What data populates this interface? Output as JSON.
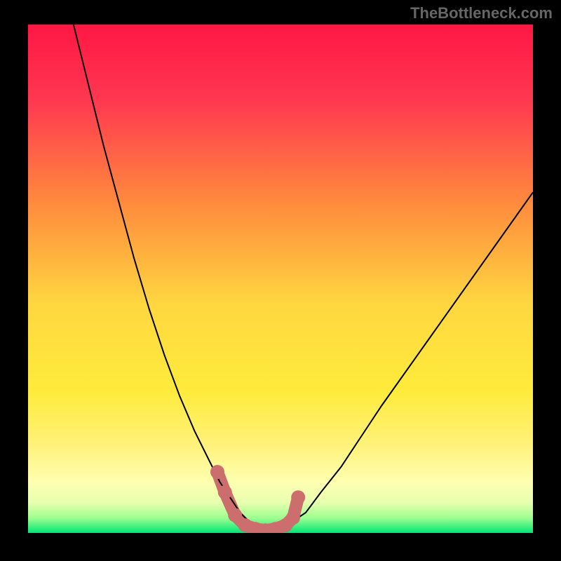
{
  "watermark": "TheBottleneck.com",
  "chart_data": {
    "type": "line",
    "title": "",
    "xlabel": "",
    "ylabel": "",
    "xlim": [
      0,
      100
    ],
    "ylim": [
      0,
      100
    ],
    "background_gradient": {
      "stops": [
        {
          "offset": 0.0,
          "color": "#ff1744"
        },
        {
          "offset": 0.15,
          "color": "#ff3850"
        },
        {
          "offset": 0.35,
          "color": "#ff8a3d"
        },
        {
          "offset": 0.55,
          "color": "#ffd740"
        },
        {
          "offset": 0.72,
          "color": "#ffeb3b"
        },
        {
          "offset": 0.82,
          "color": "#fff176"
        },
        {
          "offset": 0.9,
          "color": "#ffffb0"
        },
        {
          "offset": 0.94,
          "color": "#e8ffb0"
        },
        {
          "offset": 0.97,
          "color": "#a0ff90"
        },
        {
          "offset": 1.0,
          "color": "#00e676"
        }
      ]
    },
    "series": [
      {
        "name": "bottleneck-curve",
        "color": "#000000",
        "x": [
          9,
          12,
          15,
          18,
          21,
          24,
          27,
          30,
          33,
          36,
          38,
          40,
          42,
          44,
          46,
          48,
          50,
          52,
          55,
          58,
          62,
          66,
          70,
          75,
          80,
          85,
          90,
          95,
          100
        ],
        "y": [
          100,
          88,
          76,
          65,
          54,
          44,
          35,
          27,
          20,
          14,
          10,
          7,
          4,
          2,
          1,
          0.5,
          1,
          2,
          4,
          8,
          13,
          19,
          25,
          32,
          39,
          46,
          53,
          60,
          67
        ]
      }
    ],
    "markers": [
      {
        "x": 37.5,
        "y": 12,
        "color": "#cd6e6e",
        "size": 10
      },
      {
        "x": 39,
        "y": 8,
        "color": "#cd6e6e",
        "size": 10
      },
      {
        "x": 41,
        "y": 3.5,
        "color": "#cd6e6e",
        "size": 10
      },
      {
        "x": 43,
        "y": 1.5,
        "color": "#cd6e6e",
        "size": 10
      },
      {
        "x": 45,
        "y": 0.8,
        "color": "#cd6e6e",
        "size": 10
      },
      {
        "x": 47,
        "y": 0.5,
        "color": "#cd6e6e",
        "size": 10
      },
      {
        "x": 49,
        "y": 0.8,
        "color": "#cd6e6e",
        "size": 10
      },
      {
        "x": 51,
        "y": 1.5,
        "color": "#cd6e6e",
        "size": 10
      },
      {
        "x": 52.5,
        "y": 3,
        "color": "#cd6e6e",
        "size": 10
      },
      {
        "x": 53.5,
        "y": 7,
        "color": "#cd6e6e",
        "size": 10
      }
    ]
  }
}
